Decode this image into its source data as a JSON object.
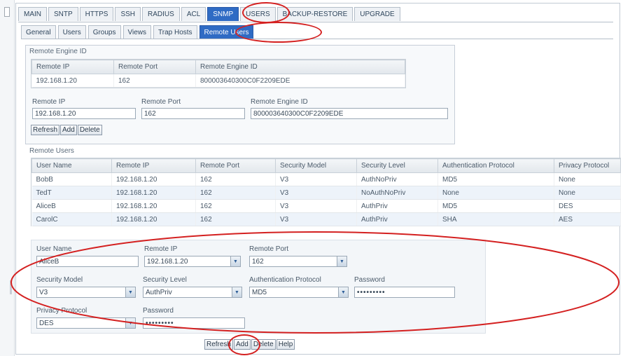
{
  "main_tabs": [
    "MAIN",
    "SNTP",
    "HTTPS",
    "SSH",
    "RADIUS",
    "ACL",
    "SNMP",
    "USERS",
    "BACKUP-RESTORE",
    "UPGRADE"
  ],
  "sub_tabs": [
    "General",
    "Users",
    "Groups",
    "Views",
    "Trap Hosts",
    "Remote Users"
  ],
  "engine": {
    "title": "Remote Engine ID",
    "columns": [
      "Remote IP",
      "Remote Port",
      "Remote Engine ID"
    ],
    "rows": [
      [
        "192.168.1.20",
        "162",
        "800003640300C0F2209EDE"
      ]
    ],
    "form": {
      "ip_label": "Remote IP",
      "ip_value": "192.168.1.20",
      "port_label": "Remote Port",
      "port_value": "162",
      "engine_label": "Remote Engine ID",
      "engine_value": "800003640300C0F2209EDE"
    },
    "buttons": {
      "refresh": "Refresh",
      "add": "Add",
      "delete": "Delete"
    }
  },
  "users": {
    "title": "Remote Users",
    "columns": [
      "User Name",
      "Remote IP",
      "Remote Port",
      "Security Model",
      "Security Level",
      "Authentication Protocol",
      "Privacy Protocol"
    ],
    "rows": [
      [
        "BobB",
        "192.168.1.20",
        "162",
        "V3",
        "AuthNoPriv",
        "MD5",
        "None"
      ],
      [
        "TedT",
        "192.168.1.20",
        "162",
        "V3",
        "NoAuthNoPriv",
        "None",
        "None"
      ],
      [
        "AliceB",
        "192.168.1.20",
        "162",
        "V3",
        "AuthPriv",
        "MD5",
        "DES"
      ],
      [
        "CarolC",
        "192.168.1.20",
        "162",
        "V3",
        "AuthPriv",
        "SHA",
        "AES"
      ]
    ],
    "form": {
      "username_label": "User Name",
      "username_value": "AliceB",
      "ip_label": "Remote IP",
      "ip_value": "192.168.1.20",
      "port_label": "Remote Port",
      "port_value": "162",
      "model_label": "Security Model",
      "model_value": "V3",
      "level_label": "Security Level",
      "level_value": "AuthPriv",
      "auth_label": "Authentication Protocol",
      "auth_value": "MD5",
      "password_label": "Password",
      "password_value": "•••••••••",
      "privacy_label": "Privacy Protocol",
      "privacy_value": "DES",
      "privpass_label": "Password",
      "privpass_value": "•••••••••"
    },
    "buttons": {
      "refresh": "Refresh",
      "add": "Add",
      "delete": "Delete",
      "help": "Help"
    }
  },
  "colors": {
    "active_tab": "#2f6bc4",
    "annotation": "#d42020",
    "row_alt": "#edf3fa"
  },
  "icons": {
    "dropdown": "chevron-down-icon"
  }
}
